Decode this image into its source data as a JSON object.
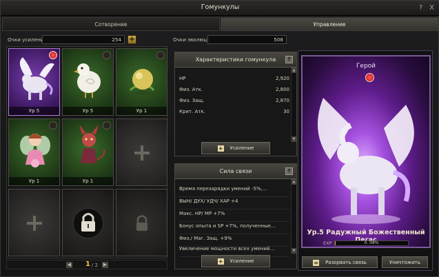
{
  "window": {
    "title": "Гомункулы",
    "help_icon": "?",
    "close_icon": "X"
  },
  "tabs": [
    {
      "label": "Сотворение",
      "active": false
    },
    {
      "label": "Управление",
      "active": true
    }
  ],
  "stats": {
    "enhance_label": "Очки усиления",
    "enhance_value": "254",
    "evolution_label": "Очки эволюции",
    "evolution_value": "508"
  },
  "slots": [
    {
      "level": "Ур 5",
      "style": "purple",
      "favorite": true,
      "creature": "pegasus"
    },
    {
      "level": "Ур 5",
      "style": "green",
      "favorite": false,
      "creature": "chick"
    },
    {
      "level": "Ур 1",
      "style": "green",
      "favorite": false,
      "creature": "seed"
    },
    {
      "level": "Ур 1",
      "style": "green",
      "favorite": false,
      "creature": "fairy"
    },
    {
      "level": "Ур 1",
      "style": "green",
      "favorite": false,
      "creature": "imp"
    },
    {
      "level": "",
      "style": "empty",
      "favorite": false,
      "creature": "add"
    },
    {
      "level": "",
      "style": "empty",
      "favorite": false,
      "creature": "add"
    },
    {
      "level": "",
      "style": "locked",
      "favorite": false,
      "creature": "lock-big"
    },
    {
      "level": "",
      "style": "locked",
      "favorite": false,
      "creature": "lock-small"
    }
  ],
  "pager": {
    "current": "1",
    "total": "/ 2"
  },
  "characteristics": {
    "title": "Характеристики гомункула",
    "rows": [
      {
        "label": "HP",
        "value": "2,920"
      },
      {
        "label": "Физ. Атк.",
        "value": "2,800"
      },
      {
        "label": "Физ. Защ.",
        "value": "2,870"
      },
      {
        "label": "Крит. Атк.",
        "value": "30"
      }
    ],
    "button": "Усиление"
  },
  "bond": {
    "title": "Сила связи",
    "rows": [
      "Время перезарядки умений -5%,...",
      "ВЫН/ ДУХ/ УДЧ/ ХАР +4",
      "Макс. HP/ MP +7%",
      "Бонус опыта и SP +7%, полученные...",
      "Физ./ Маг. Защ. +9%",
      "Увеличение мощности всех умений..."
    ],
    "button": "Усиление"
  },
  "hero": {
    "label": "Герой",
    "name": "Ур.5 Радужный Божественный Пегас",
    "exp_label": "EXP",
    "exp_text": "0. 08%",
    "exp_percent": 0.08,
    "break_button": "Разорвать связь",
    "destroy_button": "Уничтожить"
  }
}
